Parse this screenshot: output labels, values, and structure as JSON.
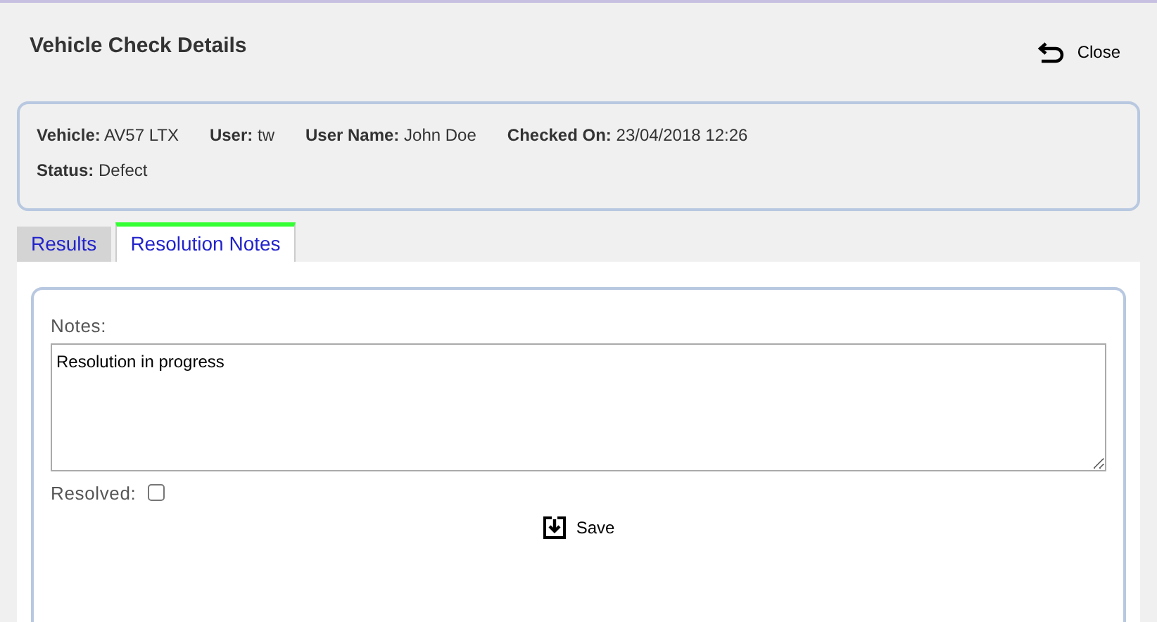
{
  "title": "Vehicle Check Details",
  "close_button": {
    "label": "Close"
  },
  "info_rows": [
    [
      {
        "label": "Vehicle:",
        "value": "AV57 LTX"
      },
      {
        "label": "User:",
        "value": "tw"
      },
      {
        "label": "User Name:",
        "value": "John Doe"
      },
      {
        "label": "Checked On:",
        "value": "23/04/2018 12:26"
      }
    ],
    [
      {
        "label": "Status:",
        "value": "Defect"
      }
    ]
  ],
  "tabs": [
    {
      "label": "Results",
      "selected": false
    },
    {
      "label": "Resolution Notes",
      "selected": true
    }
  ],
  "notes": {
    "label": "Notes:",
    "value": "Resolution in progress"
  },
  "resolved": {
    "label": "Resolved:",
    "checked": false
  },
  "save_button": {
    "label": "Save"
  }
}
